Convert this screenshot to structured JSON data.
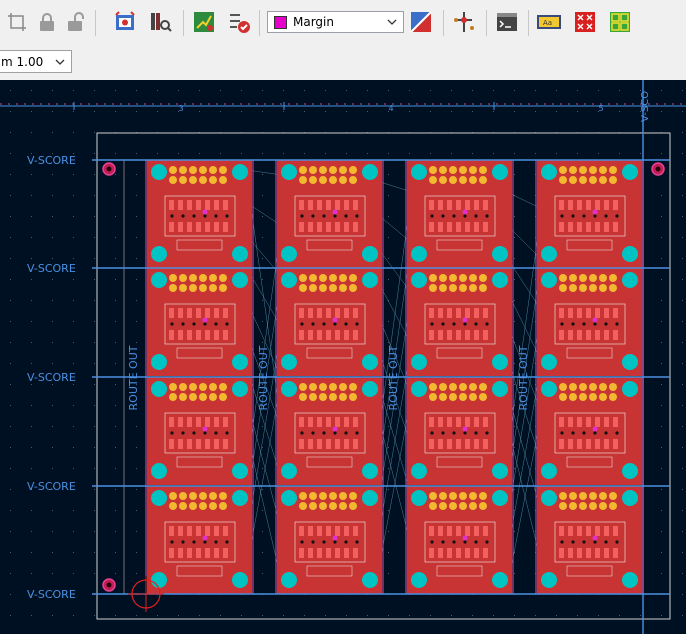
{
  "toolbar": {
    "icons": [
      "grid-origin-icon",
      "lock-icon",
      "unlock-icon",
      "board-setup-icon",
      "footprint-library-icon",
      "route-icon",
      "drc-icon",
      "layer-preset-icon",
      "track-tool-icon",
      "scripting-console-icon",
      "text-var-icon",
      "plugin-a-icon",
      "plugin-b-icon"
    ],
    "layer_select": {
      "label": "Margin",
      "color": "#e600cc"
    }
  },
  "subbar": {
    "zoom_label": "m 1.00"
  },
  "canvas": {
    "ruler_labels": [
      "3",
      "4",
      "5"
    ],
    "vscore_labels": [
      "V-SCORE",
      "V-SCORE",
      "V-SCORE",
      "V-SCORE",
      "V-SCORE"
    ],
    "vscore_top_label": "V-SCO",
    "route_labels": [
      "ROUTE OUT",
      "ROUTE OUT",
      "ROUTE OUT",
      "ROUTE OUT"
    ],
    "colors": {
      "background": "#001023",
      "copper_front": "#c83434",
      "copper_pad": "#f2b830",
      "silk": "#f0f0f0",
      "edge": "#d0d0d0",
      "mounting_hole": "#00c4c4",
      "score_line": "#4a90e2",
      "cursor": "#e02020"
    }
  }
}
